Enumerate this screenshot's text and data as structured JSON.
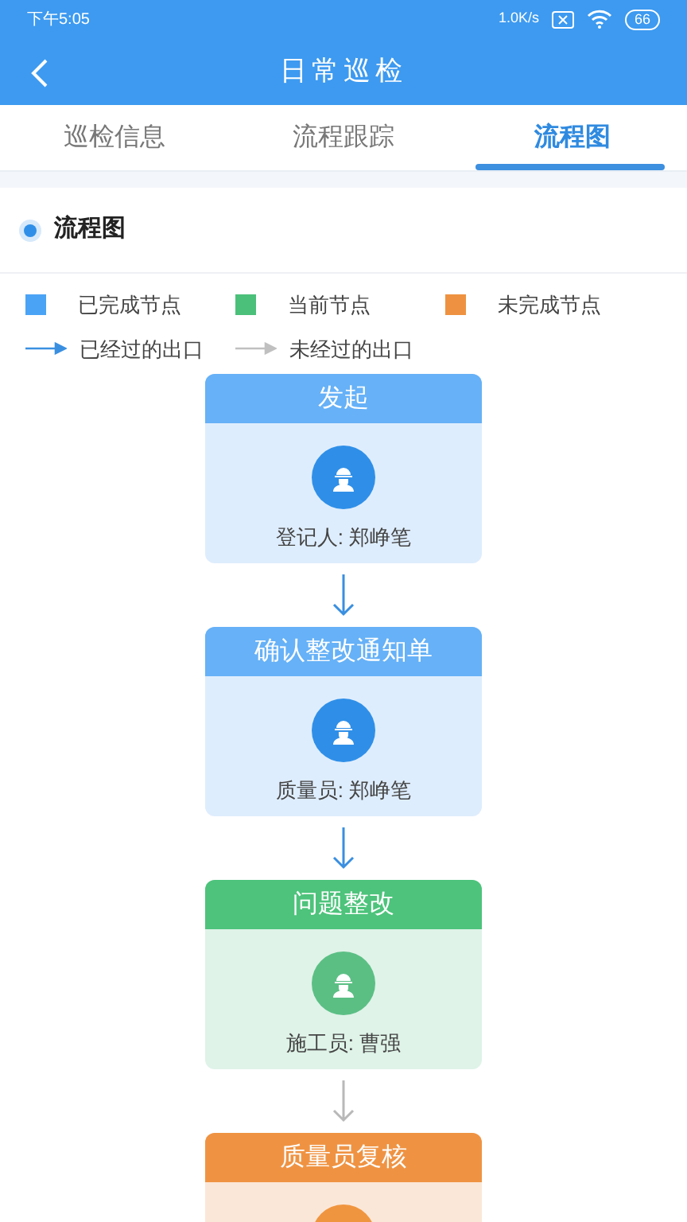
{
  "status_bar": {
    "time": "下午5:05",
    "speed": "1.0K/s",
    "battery": "66"
  },
  "header": {
    "title": "日常巡检"
  },
  "tabs": [
    {
      "label": "巡检信息",
      "selected": false
    },
    {
      "label": "流程跟踪",
      "selected": false
    },
    {
      "label": "流程图",
      "selected": true
    }
  ],
  "section": {
    "title": "流程图"
  },
  "legend": {
    "nodes": [
      {
        "label": "已完成节点",
        "kind": "done"
      },
      {
        "label": "当前节点",
        "kind": "current"
      },
      {
        "label": "未完成节点",
        "kind": "pending"
      }
    ],
    "exits": [
      {
        "label": "已经过的出口",
        "passed": true
      },
      {
        "label": "未经过的出口",
        "passed": false
      }
    ]
  },
  "flow": [
    {
      "title": "发起",
      "kind": "done",
      "person": "登记人: 郑峥笔",
      "exit_passed": true
    },
    {
      "title": "确认整改通知单",
      "kind": "done",
      "person": "质量员: 郑峥笔",
      "exit_passed": true
    },
    {
      "title": "问题整改",
      "kind": "current",
      "person": "施工员: 曹强",
      "exit_passed": false
    },
    {
      "title": "质量员复核",
      "kind": "pending"
    }
  ]
}
